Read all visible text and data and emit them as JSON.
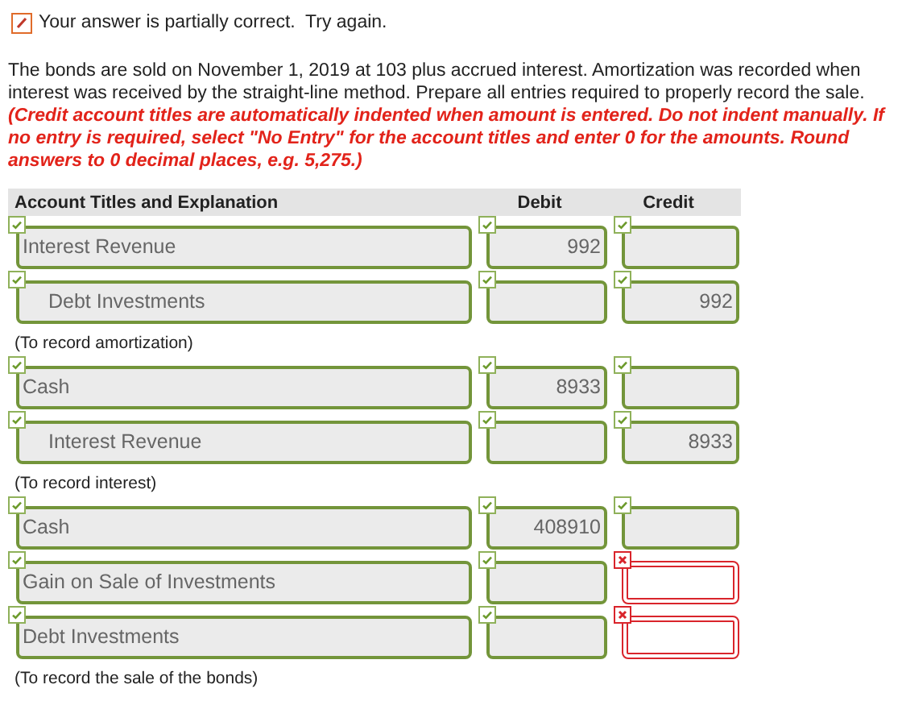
{
  "feedback": {
    "kind": "partial",
    "text": "Your answer is partially correct.  Try again."
  },
  "question": "The bonds are sold on November 1, 2019 at 103 plus accrued interest. Amortization was recorded when interest was received by the straight-line method. Prepare all entries required to properly record the sale.",
  "instructions": "(Credit account titles are automatically indented when amount is entered. Do not indent manually. If no entry is required, select \"No Entry\" for the account titles and enter 0 for the amounts. Round answers to 0 decimal places, e.g. 5,275.)",
  "table": {
    "columns": [
      "Account Titles and Explanation",
      "Debit",
      "Credit"
    ],
    "entries": [
      {
        "rows": [
          {
            "account": "Interest Revenue",
            "indented": false,
            "debit": "992",
            "account_correct": true,
            "debit_correct": true,
            "credit_correct": true
          },
          {
            "account": "Debt Investments",
            "indented": true,
            "credit": "992",
            "account_correct": true,
            "debit_correct": true,
            "credit_correct": true
          }
        ],
        "note": "(To record amortization)"
      },
      {
        "rows": [
          {
            "account": "Cash",
            "indented": false,
            "debit": "8933",
            "account_correct": true,
            "debit_correct": true,
            "credit_correct": true
          },
          {
            "account": "Interest Revenue",
            "indented": true,
            "credit": "8933",
            "account_correct": true,
            "debit_correct": true,
            "credit_correct": true
          }
        ],
        "note": "(To record interest)"
      },
      {
        "rows": [
          {
            "account": "Cash",
            "indented": false,
            "debit": "408910",
            "account_correct": true,
            "debit_correct": true,
            "credit_correct": true
          },
          {
            "account": "Gain on Sale of Investments",
            "indented": false,
            "account_correct": true,
            "debit_correct": true,
            "credit_correct": false
          },
          {
            "account": "Debt Investments",
            "indented": false,
            "account_correct": true,
            "debit_correct": true,
            "credit_correct": false
          }
        ],
        "note": "(To record the sale of the bonds)"
      }
    ]
  }
}
